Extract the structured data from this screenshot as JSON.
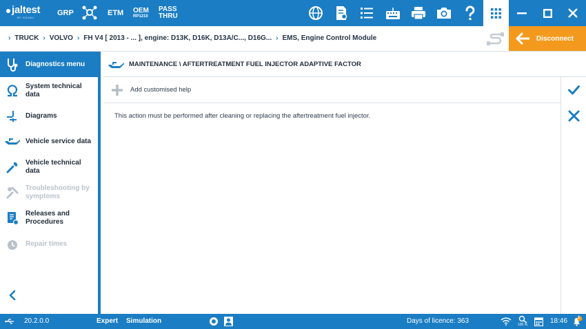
{
  "app": {
    "logo_text": "jaltest",
    "logo_sub": "BY COJALI"
  },
  "topbar": {
    "grp_label": "GRP",
    "etm_label": "ETM",
    "oem_label": "OEM",
    "oem_sub": "RP1210",
    "pass_label": "PASS",
    "thru_label": "THRU",
    "icons": [
      "network-icon",
      "gear-network-icon",
      "globe-icon",
      "document-search-icon",
      "list-icon",
      "keyboard-icon",
      "printer-icon",
      "camera-icon",
      "help-icon",
      "apps-grid-icon",
      "minimize-icon",
      "maximize-icon",
      "close-icon"
    ]
  },
  "breadcrumb": {
    "items": [
      "TRUCK",
      "VOLVO",
      "FH V4 [ 2013 - ... ], engine: D13K, D16K, D13A/C..., D16G...",
      "EMS, Engine Control Module"
    ],
    "disconnect_label": "Disconnect"
  },
  "sidebar": {
    "header": "Diagnostics menu",
    "items": [
      {
        "label": "System technical data",
        "icon": "omega-icon",
        "enabled": true
      },
      {
        "label": "Diagrams",
        "icon": "diagram-icon",
        "enabled": true
      },
      {
        "label": "Vehicle service data",
        "icon": "oil-can-icon",
        "enabled": true
      },
      {
        "label": "Vehicle technical data",
        "icon": "wrench-icon",
        "enabled": true
      },
      {
        "label": "Troubleshooting by symptoms",
        "icon": "tools-icon",
        "enabled": false
      },
      {
        "label": "Releases and Procedures",
        "icon": "procedures-icon",
        "enabled": true
      },
      {
        "label": "Repair times",
        "icon": "repair-clock-icon",
        "enabled": false
      }
    ]
  },
  "main": {
    "title": "MAINTENANCE \\ AFTERTREATMENT FUEL INJECTOR ADAPTIVE FACTOR",
    "add_help_label": "Add customised help",
    "description": "This action must be performed after cleaning or replacing the aftertreatment fuel injector."
  },
  "statusbar": {
    "version": "20.2.0.0",
    "mode": "Expert",
    "simulation": "Simulation",
    "licence": "Days of licence: 363",
    "zoom": "100 %",
    "time": "18:46",
    "notifications": "1"
  },
  "colors": {
    "primary": "#1b7dc4",
    "accent": "#f39a1e"
  }
}
